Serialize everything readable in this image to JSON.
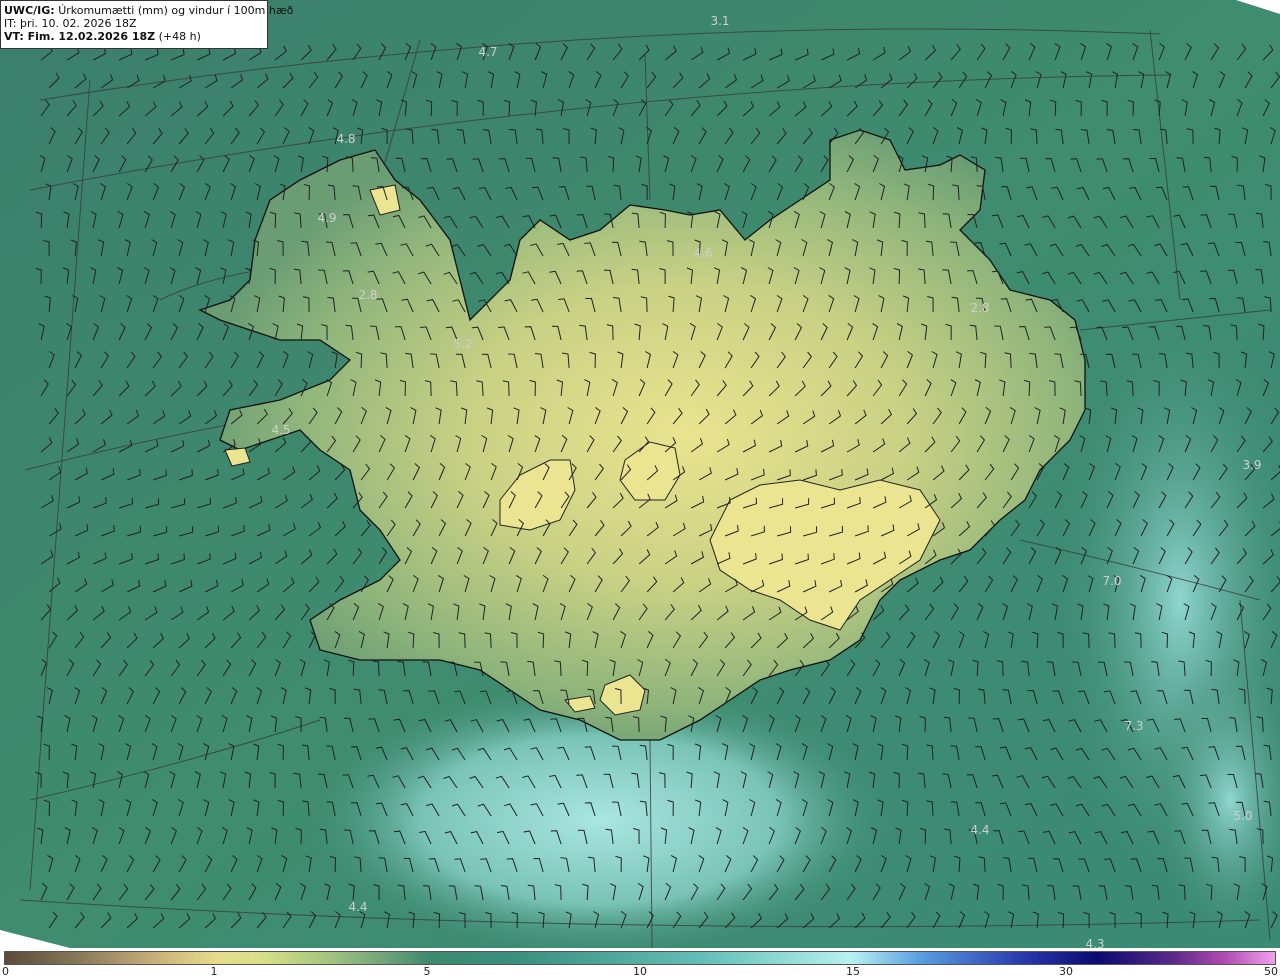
{
  "header": {
    "product_label": "UWC/IG:",
    "product_desc": "Úrkomumætti (mm) og vindur í 100m hæð",
    "init_time": "IT: þri. 10. 02. 2026 18Z",
    "valid_label": "VT: Fim. 12.02.2026 18Z",
    "valid_offset": "(+48 h)"
  },
  "map_values": [
    "3.1",
    "4.7",
    "4.8",
    "4.9",
    "2.8",
    "5.2",
    "4.6",
    "2.8",
    "4.5",
    "3.9",
    "7.0",
    "7.3",
    "4.4",
    "5.0",
    "4.4",
    "4.3"
  ],
  "colorbar": {
    "ticks": [
      "0",
      "1",
      "5",
      "10",
      "15",
      "30",
      "50"
    ],
    "colors": {
      "dry": "#5a4a3a",
      "low": "#e6dd8a",
      "mid": "#3e8a6e",
      "high": "#b9f0f0",
      "heavy": "#0a0a70",
      "extreme": "#f0a0f0"
    }
  },
  "map_colors": {
    "ocean": "#3d8a6e",
    "land_low": "#8eb57a",
    "land_high": "#e4e08e",
    "wet_zone": "#8fd6d0",
    "coast": "#111111",
    "graticule": "#3a3a3a",
    "barb": "#222222"
  }
}
